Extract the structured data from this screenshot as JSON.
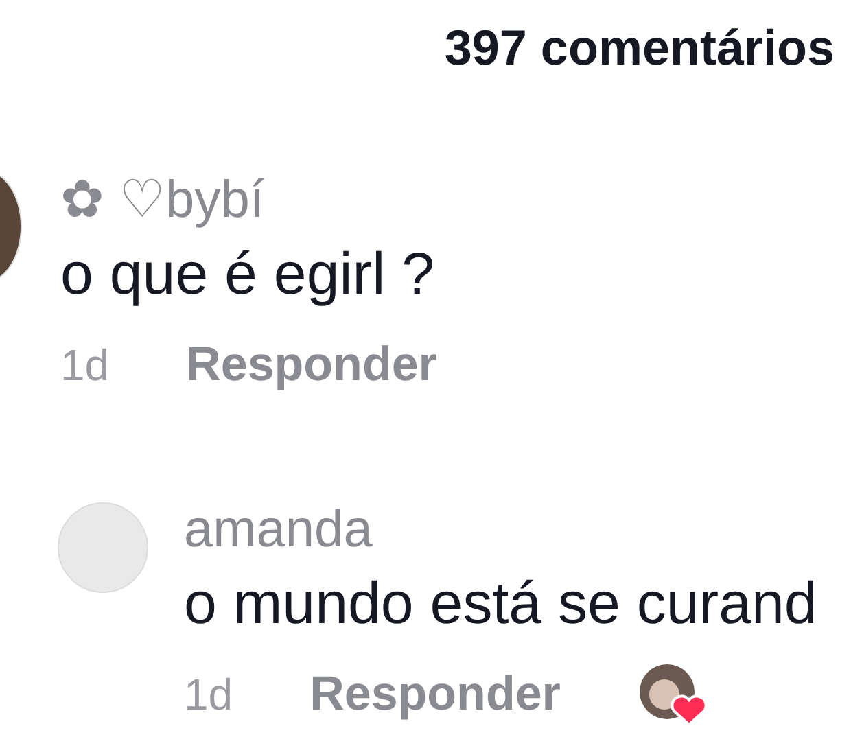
{
  "header": {
    "count": "397 comentários"
  },
  "comments": [
    {
      "kind": "comment",
      "username": "✿ ♡bybí",
      "text": "o que é egirl ?",
      "time": "1d",
      "reply_label": "Responder",
      "liked_by_creator": false
    },
    {
      "kind": "reply",
      "username": "amanda",
      "text": "o mundo está se curand",
      "time": "1d",
      "reply_label": "Responder",
      "liked_by_creator": true
    }
  ]
}
